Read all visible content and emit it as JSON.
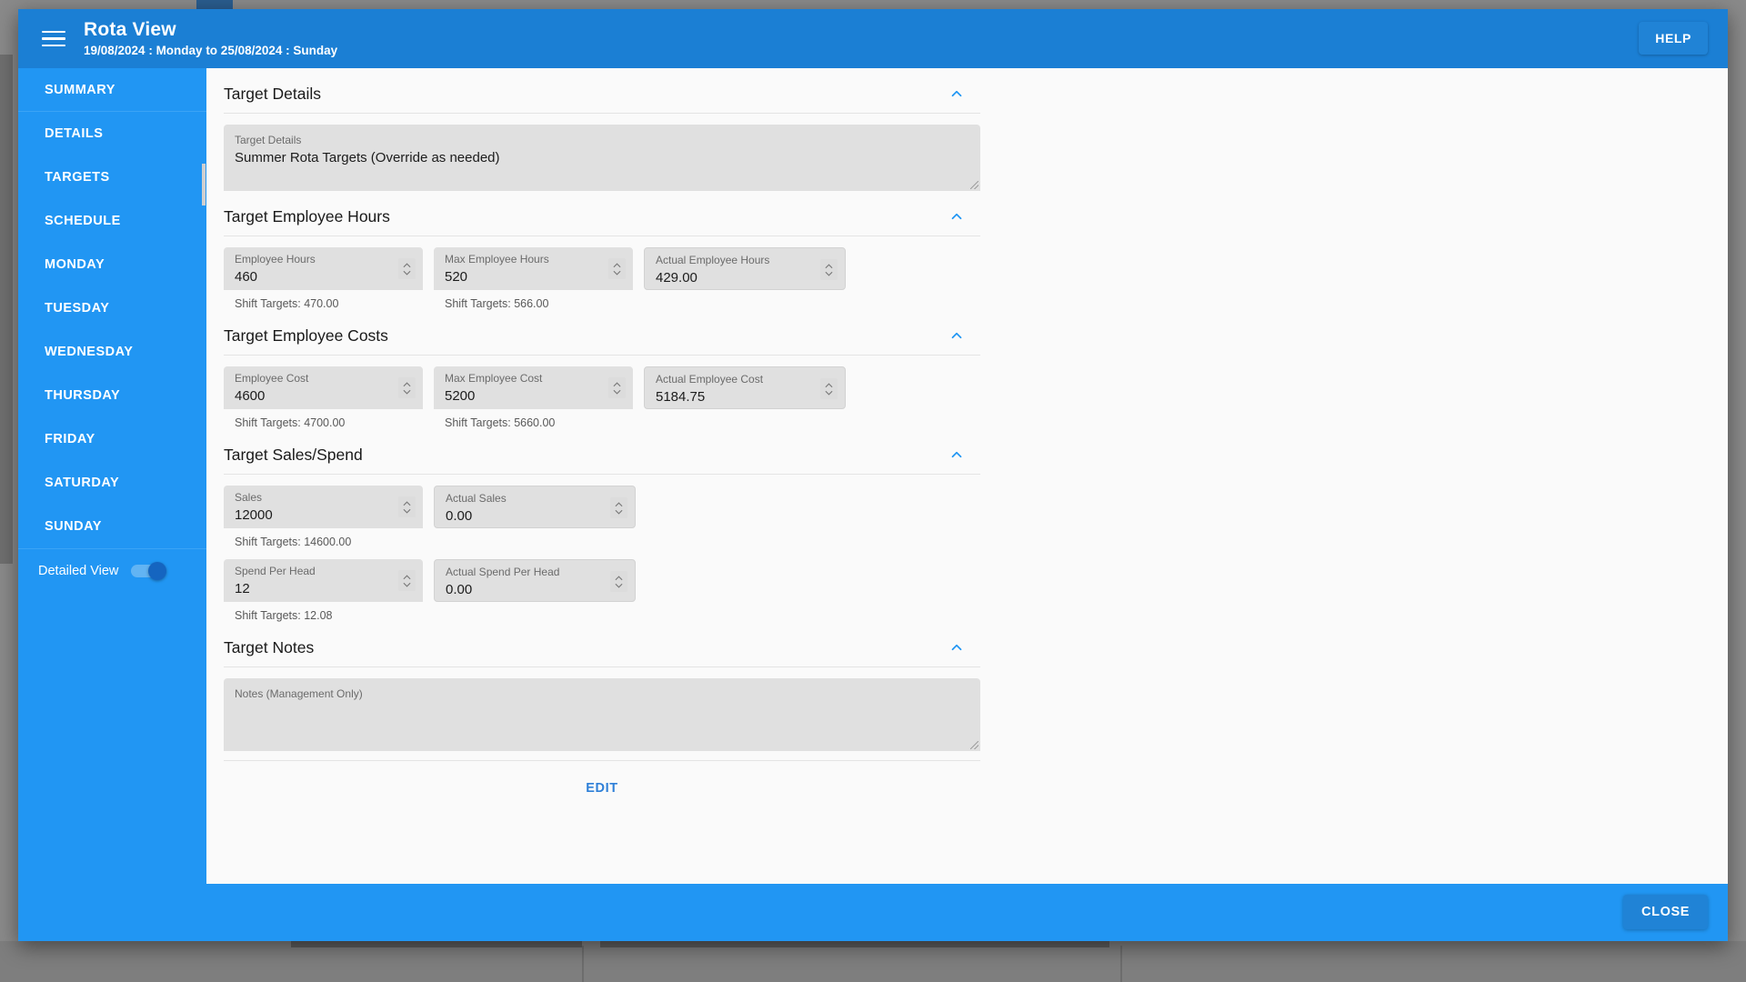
{
  "header": {
    "title": "Rota View",
    "subtitle": "19/08/2024 : Monday to 25/08/2024 : Sunday",
    "menu_icon": "hamburger-icon",
    "help_label": "HELP"
  },
  "sidebar": {
    "items": [
      {
        "label": "SUMMARY"
      },
      {
        "label": "DETAILS"
      },
      {
        "label": "TARGETS"
      },
      {
        "label": "SCHEDULE"
      },
      {
        "label": "MONDAY"
      },
      {
        "label": "TUESDAY"
      },
      {
        "label": "WEDNESDAY"
      },
      {
        "label": "THURSDAY"
      },
      {
        "label": "FRIDAY"
      },
      {
        "label": "SATURDAY"
      },
      {
        "label": "SUNDAY"
      }
    ],
    "detailed_view": {
      "label": "Detailed View",
      "on": true
    }
  },
  "sections": {
    "target_details": {
      "title": "Target Details",
      "collapse_icon": "chevron-up-icon",
      "field": {
        "label": "Target Details",
        "value": "Summer Rota Targets (Override as needed)"
      }
    },
    "target_employee_hours": {
      "title": "Target Employee Hours",
      "collapse_icon": "chevron-up-icon",
      "fields": [
        {
          "label": "Employee Hours",
          "value": "460",
          "shift": "Shift Targets: 470.00",
          "spinner": true,
          "actual": false
        },
        {
          "label": "Max Employee Hours",
          "value": "520",
          "shift": "Shift Targets: 566.00",
          "spinner": true,
          "actual": false
        },
        {
          "label": "Actual Employee Hours",
          "value": "429.00",
          "shift": "",
          "spinner": true,
          "actual": true
        }
      ]
    },
    "target_employee_costs": {
      "title": "Target Employee Costs",
      "collapse_icon": "chevron-up-icon",
      "fields": [
        {
          "label": "Employee Cost",
          "value": "4600",
          "shift": "Shift Targets: 4700.00",
          "spinner": true,
          "actual": false
        },
        {
          "label": "Max Employee Cost",
          "value": "5200",
          "shift": "Shift Targets: 5660.00",
          "spinner": true,
          "actual": false
        },
        {
          "label": "Actual Employee Cost",
          "value": "5184.75",
          "shift": "",
          "spinner": true,
          "actual": true
        }
      ]
    },
    "target_sales_spend": {
      "title": "Target Sales/Spend",
      "collapse_icon": "chevron-up-icon",
      "row1": [
        {
          "label": "Sales",
          "value": "12000",
          "shift": "Shift Targets: 14600.00",
          "spinner": true
        },
        {
          "label": "Actual Sales",
          "value": "0.00",
          "shift": "",
          "spinner": true
        }
      ],
      "row2": [
        {
          "label": "Spend Per Head",
          "value": "12",
          "shift": "Shift Targets: 12.08",
          "spinner": true
        },
        {
          "label": "Actual Spend Per Head",
          "value": "0.00",
          "shift": "",
          "spinner": true
        }
      ]
    },
    "target_notes": {
      "title": "Target Notes",
      "collapse_icon": "chevron-up-icon",
      "field": {
        "label": "Notes (Management Only)",
        "value": ""
      }
    }
  },
  "actions": {
    "edit_label": "EDIT",
    "close_label": "CLOSE"
  },
  "colors": {
    "brand_blue": "#2196f3",
    "header_blue": "#1b7fd4",
    "button_blue": "#2083d6",
    "link_blue": "#2f80d8",
    "field_grey": "#e0e0e0",
    "page_bg": "#fafafa"
  }
}
